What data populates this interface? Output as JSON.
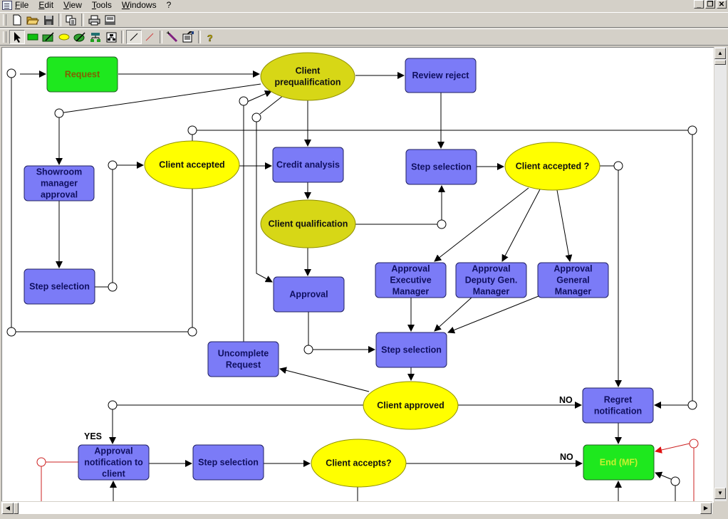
{
  "menubar": {
    "items": [
      "File",
      "Edit",
      "View",
      "Tools",
      "Windows",
      "?"
    ],
    "window_buttons": {
      "minimize": "_",
      "restore": "❐",
      "close": "✕"
    }
  },
  "toolbar1": {
    "buttons": [
      {
        "name": "new-document",
        "glyph": "🗋"
      },
      {
        "name": "open-folder",
        "glyph": "📂"
      },
      {
        "name": "save",
        "glyph": "💾"
      },
      {
        "name": "copy",
        "glyph": "⧉"
      },
      {
        "name": "print",
        "glyph": "🖶"
      },
      {
        "name": "print-preview",
        "glyph": "▤"
      }
    ]
  },
  "toolbar2": {
    "buttons": [
      {
        "name": "select-pointer",
        "glyph": "➤",
        "pressed": true
      },
      {
        "name": "rectangle-tool",
        "glyph": "▬"
      },
      {
        "name": "edit-rectangle",
        "glyph": "✎"
      },
      {
        "name": "ellipse-tool",
        "glyph": "⬬"
      },
      {
        "name": "edit-ellipse",
        "glyph": "✎"
      },
      {
        "name": "hierarchy",
        "glyph": "⊤"
      },
      {
        "name": "org-chart",
        "glyph": "⊞"
      },
      {
        "name": "black-line",
        "glyph": "╱",
        "pressed": true
      },
      {
        "name": "red-line",
        "glyph": "╱"
      },
      {
        "name": "magic-wand",
        "glyph": "✐"
      },
      {
        "name": "properties",
        "glyph": "☰"
      },
      {
        "name": "help",
        "glyph": "?"
      }
    ]
  },
  "diagram": {
    "colors": {
      "task": "#7b7bf7",
      "decision_bright": "#ffff00",
      "decision_olive": "#d7d716",
      "terminal": "#1ee81e",
      "task_text": "#101060",
      "terminal_text_request": "#806000",
      "terminal_text_end": "#c8f030",
      "edge": "#000000",
      "red_edge": "#cc2020"
    },
    "nodes": {
      "request": {
        "label": [
          "Request"
        ]
      },
      "client_prequalification": {
        "label": [
          "Client",
          "prequalification"
        ]
      },
      "review_reject": {
        "label": [
          "Review reject"
        ]
      },
      "showroom_manager_approval": {
        "label": [
          "Showroom",
          "manager",
          "approval"
        ]
      },
      "client_accepted": {
        "label": [
          "Client accepted"
        ]
      },
      "credit_analysis": {
        "label": [
          "Credit analysis"
        ]
      },
      "step_selection_top": {
        "label": [
          "Step selection"
        ]
      },
      "client_accepted_q": {
        "label": [
          "Client accepted ?"
        ]
      },
      "client_qualification": {
        "label": [
          "Client qualification"
        ]
      },
      "step_selection_left": {
        "label": [
          "Step selection"
        ]
      },
      "approval": {
        "label": [
          "Approval"
        ]
      },
      "approval_executive": {
        "label": [
          "Approval",
          "Executive",
          "Manager"
        ]
      },
      "approval_deputy": {
        "label": [
          "Approval",
          "Deputy Gen.",
          "Manager"
        ]
      },
      "approval_general": {
        "label": [
          "Approval",
          "General",
          "Manager"
        ]
      },
      "step_selection_mid": {
        "label": [
          "Step selection"
        ]
      },
      "uncomplete_request": {
        "label": [
          "Uncomplete",
          "Request"
        ]
      },
      "client_approved": {
        "label": [
          "Client approved"
        ]
      },
      "regret_notification": {
        "label": [
          "Regret",
          "notification"
        ]
      },
      "approval_notification": {
        "label": [
          "Approval",
          "notification to",
          "client"
        ]
      },
      "step_selection_bottom": {
        "label": [
          "Step selection"
        ]
      },
      "client_accepts": {
        "label": [
          "Client accepts?"
        ]
      },
      "end_mf": {
        "label": [
          "End (MF)"
        ]
      }
    },
    "edge_labels": {
      "yes": "YES",
      "no_regret": "NO",
      "no_end": "NO"
    }
  }
}
